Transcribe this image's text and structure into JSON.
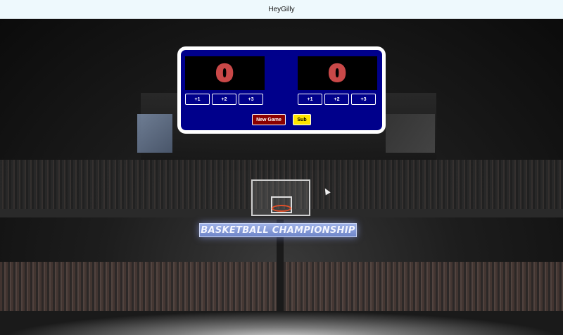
{
  "header": {
    "title": "HeyGilly"
  },
  "background": {
    "banner_text": "BASKETBALL CHAMPIONSHIP"
  },
  "scoreboard": {
    "home": {
      "score": "0",
      "buttons": [
        "+1",
        "+2",
        "+3"
      ]
    },
    "guest": {
      "score": "0",
      "buttons": [
        "+1",
        "+2",
        "+3"
      ]
    },
    "controls": {
      "new_game_label": "New Game",
      "sub_label": "Sub"
    }
  },
  "colors": {
    "board_bg": "#00008b",
    "score_digit": "#c94848",
    "new_game_bg": "#8b0000",
    "sub_bg": "#ffe600"
  }
}
